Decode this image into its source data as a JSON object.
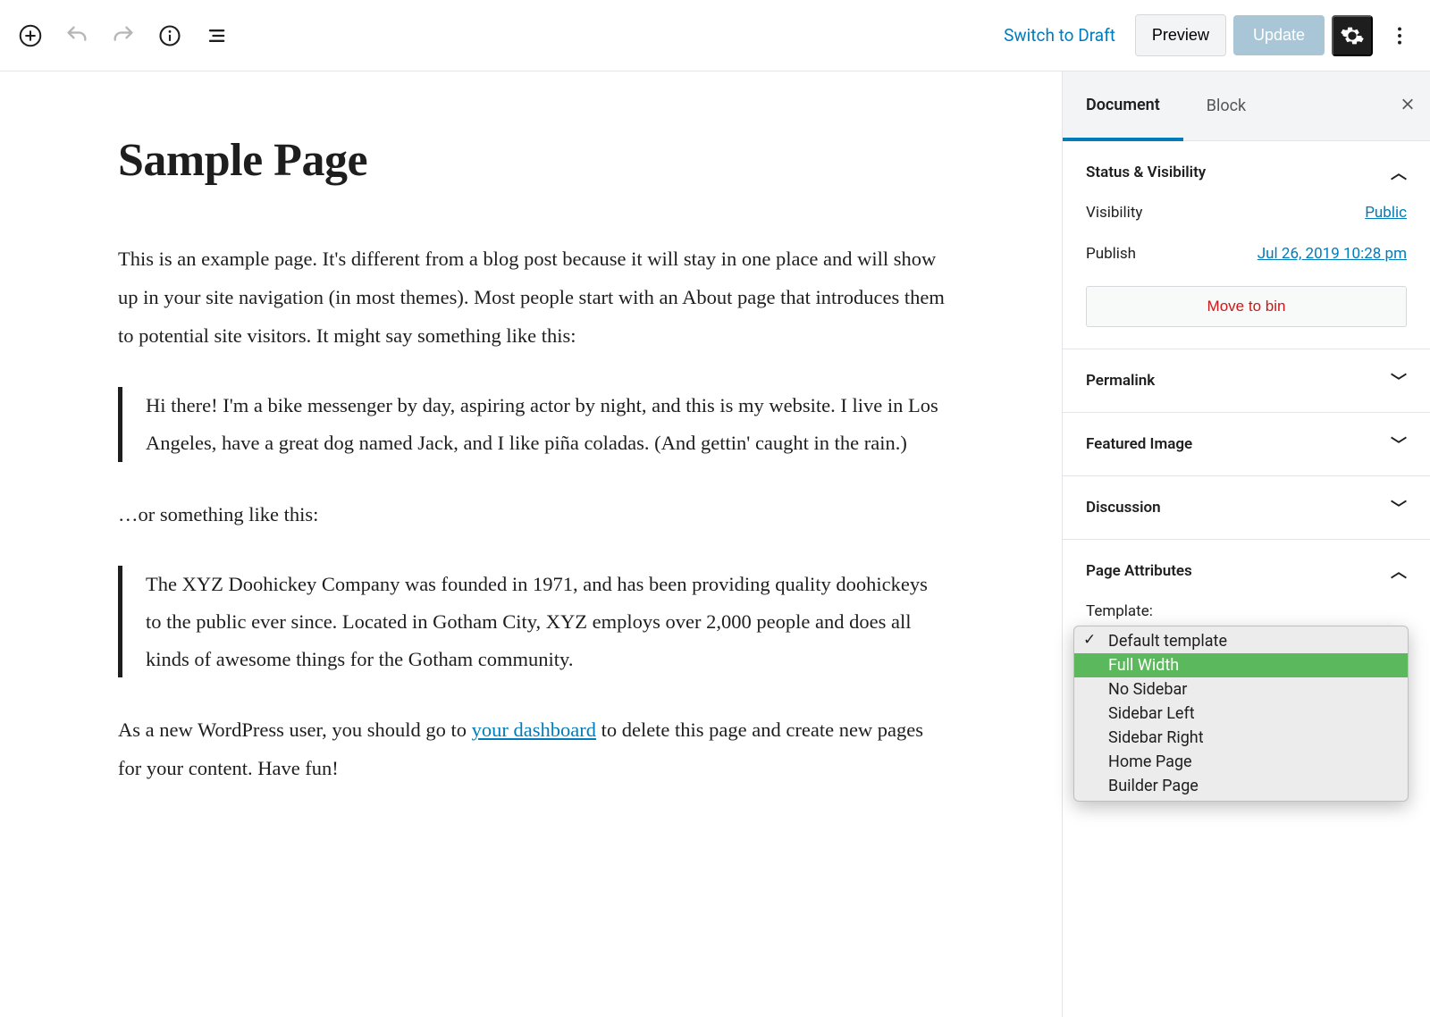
{
  "toolbar": {
    "switch_draft": "Switch to Draft",
    "preview": "Preview",
    "update": "Update"
  },
  "editor": {
    "title": "Sample Page",
    "p1": "This is an example page. It's different from a blog post because it will stay in one place and will show up in your site navigation (in most themes). Most people start with an About page that introduces them to potential site visitors. It might say something like this:",
    "quote1": "Hi there! I'm a bike messenger by day, aspiring actor by night, and this is my website. I live in Los Angeles, have a great dog named Jack, and I like piña coladas. (And gettin' caught in the rain.)",
    "p2": "…or something like this:",
    "quote2": "The XYZ Doohickey Company was founded in 1971, and has been providing quality doohickeys to the public ever since. Located in Gotham City, XYZ employs over 2,000 people and does all kinds of awesome things for the Gotham community.",
    "p3_before": "As a new WordPress user, you should go to ",
    "p3_link": "your dashboard",
    "p3_after": " to delete this page and create new pages for your content. Have fun!"
  },
  "sidebar": {
    "tabs": {
      "document": "Document",
      "block": "Block"
    },
    "status": {
      "title": "Status & Visibility",
      "visibility_label": "Visibility",
      "visibility_value": "Public",
      "publish_label": "Publish",
      "publish_value": "Jul 26, 2019 10:28 pm",
      "move_bin": "Move to bin"
    },
    "panels": {
      "permalink": "Permalink",
      "featured_image": "Featured Image",
      "discussion": "Discussion",
      "page_attributes": "Page Attributes"
    },
    "page_attributes": {
      "template_label": "Template:",
      "options": [
        {
          "label": "Default template",
          "checked": true,
          "highlight": false
        },
        {
          "label": "Full Width",
          "checked": false,
          "highlight": true
        },
        {
          "label": "No Sidebar",
          "checked": false,
          "highlight": false
        },
        {
          "label": "Sidebar Left",
          "checked": false,
          "highlight": false
        },
        {
          "label": "Sidebar Right",
          "checked": false,
          "highlight": false
        },
        {
          "label": "Home Page",
          "checked": false,
          "highlight": false
        },
        {
          "label": "Builder Page",
          "checked": false,
          "highlight": false
        }
      ]
    }
  }
}
